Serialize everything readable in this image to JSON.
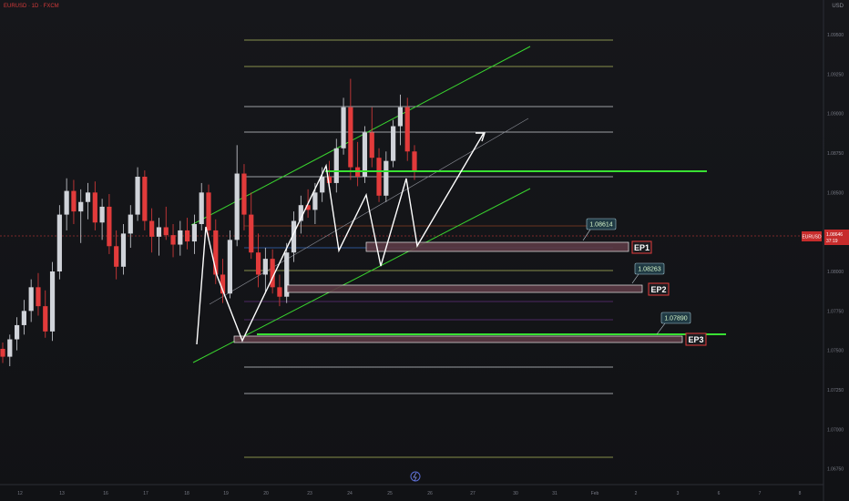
{
  "header": {
    "symbol_line": "EURUSD · 1D · FXCM",
    "scale_button": "USD"
  },
  "colors": {
    "up_candle": "#d0d3d9",
    "down_candle": "#e23b3b",
    "channel": "#39d42f",
    "zigzag": "#ffffff",
    "level_line": "#e9eef2",
    "yellow_line": "#c9d46a",
    "price_line": "#e23b3b",
    "green_level": "#39e033",
    "ep_border": "#e23b3b",
    "zone_fill": "#5c3a45"
  },
  "chart_data": {
    "type": "candlestick",
    "symbol": "EURUSD",
    "current_price": 1.08646,
    "countdown": "37:19",
    "y_ticks": [
      1.095,
      1.0925,
      1.09,
      1.0875,
      1.085,
      1.0825,
      1.08,
      1.0775,
      1.075,
      1.0725,
      1.07,
      1.0675
    ],
    "x_ticks": [
      "12",
      "13",
      "16",
      "17",
      "18",
      "19",
      "20",
      "23",
      "24",
      "25",
      "26",
      "27",
      "30",
      "31",
      "Feb",
      "2",
      "3",
      "6",
      "7",
      "8"
    ],
    "entries": [
      {
        "label": "EP1",
        "price": "1.08614"
      },
      {
        "label": "EP2",
        "price": "1.08263"
      },
      {
        "label": "EP3",
        "price": "1.07890"
      }
    ],
    "candles": [
      [
        1.0751,
        1.0755,
        1.0742,
        1.0746
      ],
      [
        1.0746,
        1.076,
        1.074,
        1.0757
      ],
      [
        1.0757,
        1.0771,
        1.075,
        1.0766
      ],
      [
        1.0766,
        1.0782,
        1.076,
        1.0775
      ],
      [
        1.0775,
        1.0795,
        1.0768,
        1.079
      ],
      [
        1.079,
        1.0799,
        1.0772,
        1.0778
      ],
      [
        1.0778,
        1.0788,
        1.0758,
        1.0762
      ],
      [
        1.0762,
        1.0806,
        1.0756,
        1.08
      ],
      [
        1.08,
        1.0842,
        1.0795,
        1.0836
      ],
      [
        1.0836,
        1.0859,
        1.0826,
        1.0851
      ],
      [
        1.0851,
        1.0858,
        1.083,
        1.0838
      ],
      [
        1.0838,
        1.0852,
        1.0818,
        1.0844
      ],
      [
        1.0844,
        1.0856,
        1.0833,
        1.085
      ],
      [
        1.085,
        1.0857,
        1.0826,
        1.0831
      ],
      [
        1.0831,
        1.0846,
        1.082,
        1.0841
      ],
      [
        1.0841,
        1.0849,
        1.0811,
        1.0816
      ],
      [
        1.0816,
        1.0826,
        1.0795,
        1.0803
      ],
      [
        1.0803,
        1.083,
        1.0798,
        1.0824
      ],
      [
        1.0824,
        1.0842,
        1.0815,
        1.0836
      ],
      [
        1.0836,
        1.0866,
        1.0832,
        1.086
      ],
      [
        1.086,
        1.0864,
        1.0826,
        1.0832
      ],
      [
        1.0832,
        1.084,
        1.0812,
        1.0822
      ],
      [
        1.0822,
        1.0834,
        1.081,
        1.0828
      ],
      [
        1.0828,
        1.0841,
        1.082,
        1.0823
      ],
      [
        1.0823,
        1.083,
        1.0809,
        1.0817
      ],
      [
        1.0817,
        1.0832,
        1.081,
        1.0826
      ],
      [
        1.0826,
        1.0834,
        1.0814,
        1.0819
      ],
      [
        1.0819,
        1.0836,
        1.0811,
        1.083
      ],
      [
        1.083,
        1.0856,
        1.0826,
        1.085
      ],
      [
        1.085,
        1.0855,
        1.0821,
        1.0826
      ],
      [
        1.0826,
        1.0833,
        1.0792,
        1.0798
      ],
      [
        1.0798,
        1.0808,
        1.078,
        1.0786
      ],
      [
        1.0786,
        1.0826,
        1.0783,
        1.082
      ],
      [
        1.082,
        1.088,
        1.0816,
        1.0862
      ],
      [
        1.0862,
        1.0868,
        1.0826,
        1.0836
      ],
      [
        1.0836,
        1.085,
        1.0808,
        1.0812
      ],
      [
        1.0812,
        1.0824,
        1.079,
        1.0798
      ],
      [
        1.0798,
        1.0815,
        1.0786,
        1.0808
      ],
      [
        1.0808,
        1.0814,
        1.0786,
        1.079
      ],
      [
        1.079,
        1.0798,
        1.0778,
        1.0784
      ],
      [
        1.0784,
        1.0818,
        1.078,
        1.0812
      ],
      [
        1.0812,
        1.0838,
        1.0806,
        1.0832
      ],
      [
        1.0832,
        1.0848,
        1.0824,
        1.0842
      ],
      [
        1.0842,
        1.0852,
        1.0834,
        1.0839
      ],
      [
        1.0839,
        1.0856,
        1.083,
        1.085
      ],
      [
        1.085,
        1.0866,
        1.0844,
        1.086
      ],
      [
        1.086,
        1.087,
        1.0852,
        1.0856
      ],
      [
        1.0856,
        1.0884,
        1.085,
        1.0878
      ],
      [
        1.0878,
        1.091,
        1.0874,
        1.0904
      ],
      [
        1.0904,
        1.0922,
        1.0858,
        1.0866
      ],
      [
        1.0866,
        1.0882,
        1.0854,
        1.086
      ],
      [
        1.086,
        1.0892,
        1.0856,
        1.0888
      ],
      [
        1.0888,
        1.0904,
        1.0866,
        1.0872
      ],
      [
        1.0872,
        1.0878,
        1.0844,
        1.0848
      ],
      [
        1.0848,
        1.0876,
        1.0844,
        1.087
      ],
      [
        1.087,
        1.0896,
        1.0866,
        1.0892
      ],
      [
        1.0892,
        1.0912,
        1.088,
        1.0904
      ],
      [
        1.0904,
        1.091,
        1.087,
        1.0876
      ],
      [
        1.0876,
        1.088,
        1.0858,
        1.0864
      ]
    ]
  }
}
